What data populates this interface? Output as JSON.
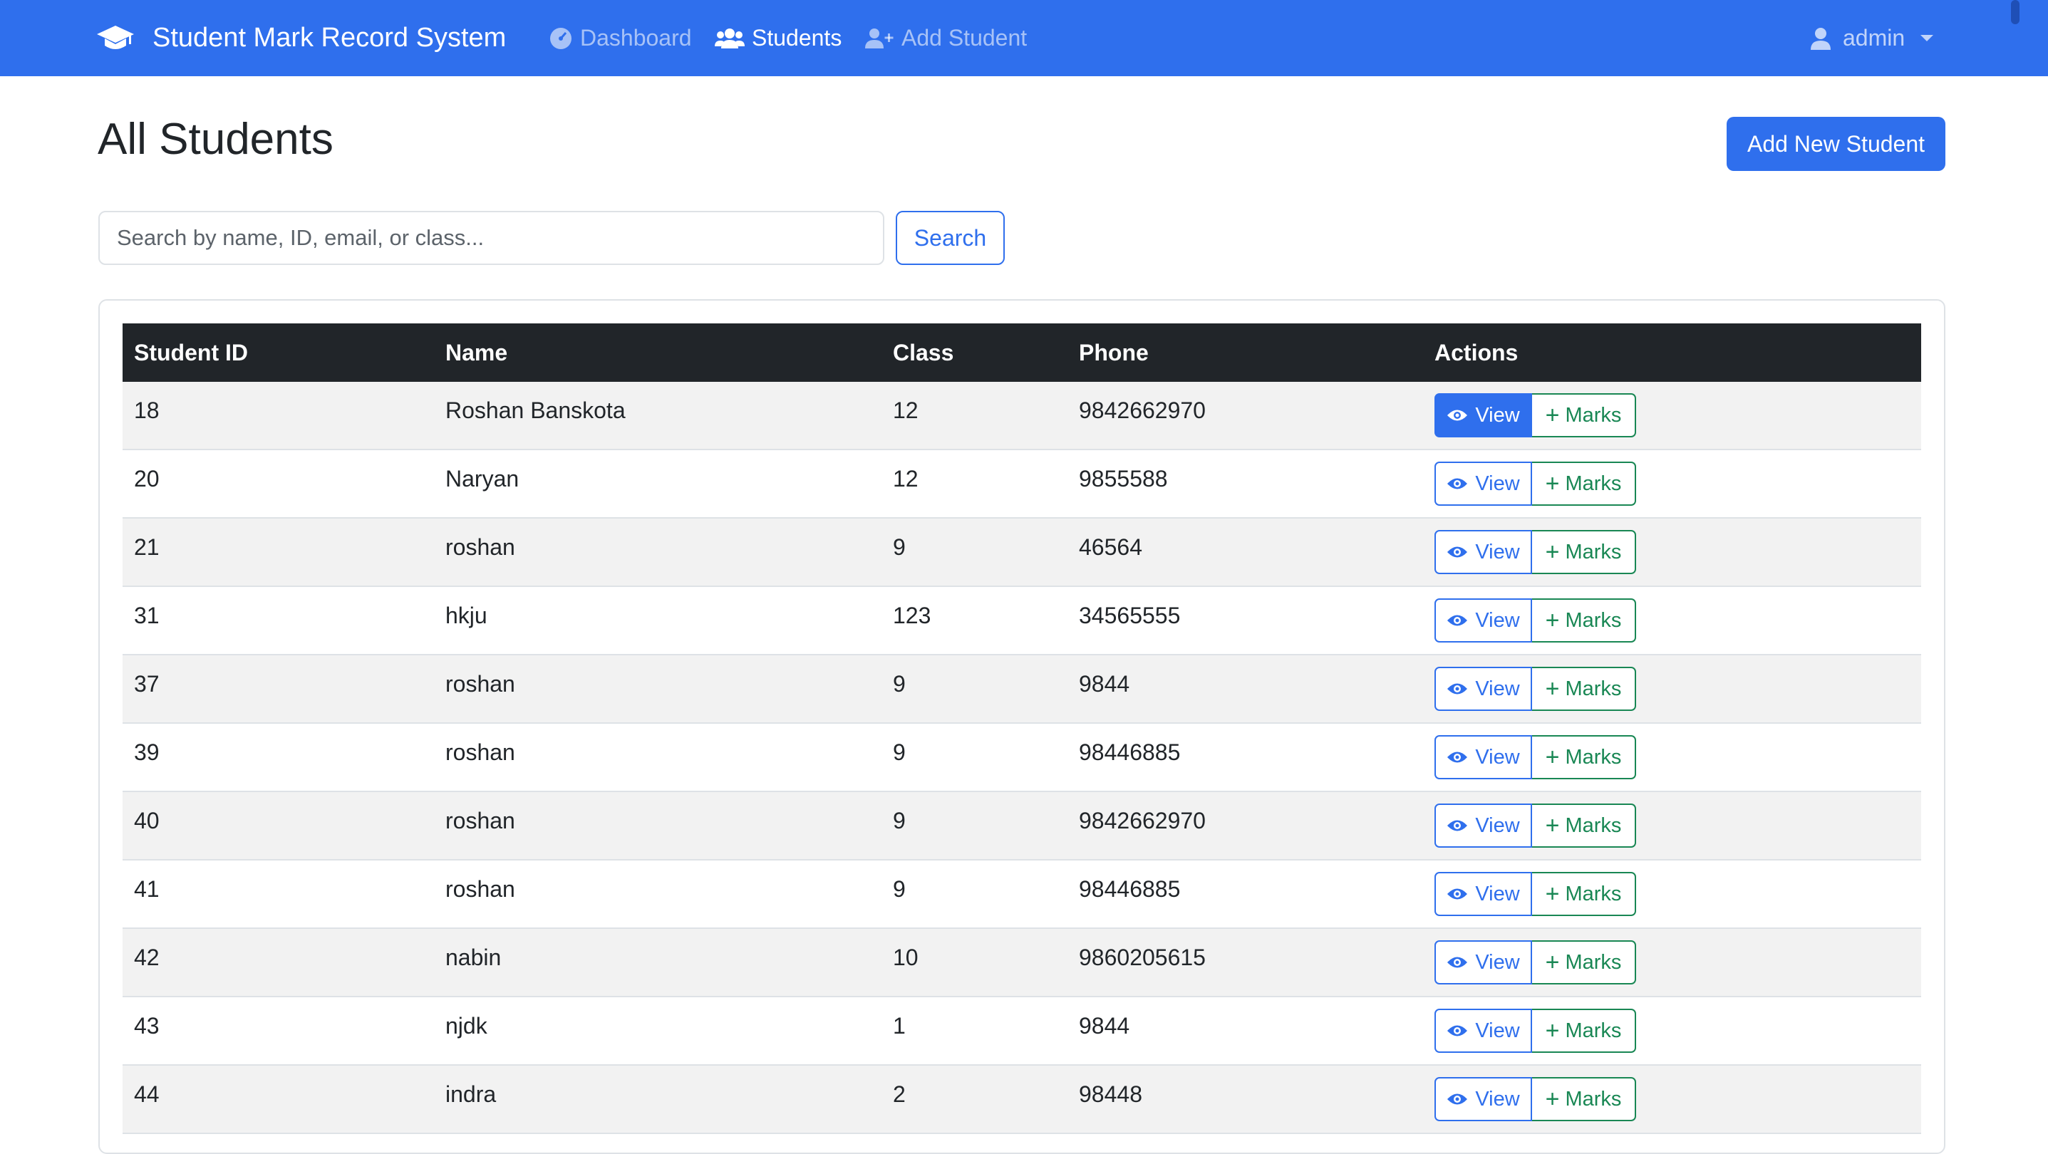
{
  "navbar": {
    "brand": "Student Mark Record System",
    "links": {
      "dashboard": "Dashboard",
      "students": "Students",
      "add_student": "Add Student"
    },
    "user": "admin"
  },
  "page": {
    "title": "All Students",
    "add_button": "Add New Student"
  },
  "search": {
    "placeholder": "Search by name, ID, email, or class...",
    "button": "Search"
  },
  "table": {
    "headers": [
      "Student ID",
      "Name",
      "Class",
      "Phone",
      "Actions"
    ],
    "view_label": "View",
    "marks_label": "Marks",
    "rows": [
      {
        "id": "18",
        "name": "Roshan Banskota",
        "class": "12",
        "phone": "9842662970"
      },
      {
        "id": "20",
        "name": "Naryan",
        "class": "12",
        "phone": "9855588"
      },
      {
        "id": "21",
        "name": "roshan",
        "class": "9",
        "phone": "46564"
      },
      {
        "id": "31",
        "name": "hkju",
        "class": "123",
        "phone": "34565555"
      },
      {
        "id": "37",
        "name": "roshan",
        "class": "9",
        "phone": "9844"
      },
      {
        "id": "39",
        "name": "roshan",
        "class": "9",
        "phone": "98446885"
      },
      {
        "id": "40",
        "name": "roshan",
        "class": "9",
        "phone": "9842662970"
      },
      {
        "id": "41",
        "name": "roshan",
        "class": "9",
        "phone": "98446885"
      },
      {
        "id": "42",
        "name": "nabin",
        "class": "10",
        "phone": "9860205615"
      },
      {
        "id": "43",
        "name": "njdk",
        "class": "1",
        "phone": "9844"
      },
      {
        "id": "44",
        "name": "indra",
        "class": "2",
        "phone": "98448"
      }
    ]
  },
  "colors": {
    "primary": "#2f6fed",
    "success": "#198754",
    "dark": "#212529"
  }
}
